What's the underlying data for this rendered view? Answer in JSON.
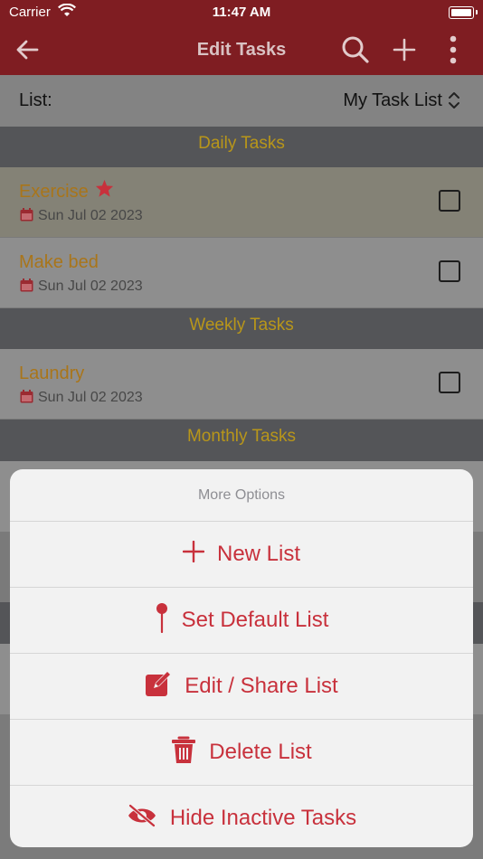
{
  "status_bar": {
    "carrier": "Carrier",
    "time": "11:47 AM"
  },
  "nav": {
    "title": "Edit Tasks"
  },
  "list_selector": {
    "label": "List:",
    "value": "My Task List"
  },
  "sections": [
    {
      "title": "Daily Tasks"
    },
    {
      "title": "Weekly Tasks"
    },
    {
      "title": "Monthly Tasks"
    }
  ],
  "tasks": [
    {
      "name": "Exercise",
      "date": "Sun Jul 02 2023",
      "starred": true
    },
    {
      "name": "Make bed",
      "date": "Sun Jul 02 2023",
      "starred": false
    },
    {
      "name": "Laundry",
      "date": "Sun Jul 02 2023",
      "starred": false
    }
  ],
  "sheet": {
    "title": "More Options",
    "options": [
      {
        "label": "New List",
        "icon": "plus-icon"
      },
      {
        "label": "Set Default List",
        "icon": "pin-icon"
      },
      {
        "label": "Edit / Share List",
        "icon": "edit-icon"
      },
      {
        "label": "Delete List",
        "icon": "trash-icon"
      },
      {
        "label": "Hide Inactive Tasks",
        "icon": "eye-slash-icon"
      }
    ]
  },
  "colors": {
    "nav_bg": "#7f1d22",
    "accent": "#c8313c",
    "section_text": "#b8961a",
    "task_text": "#a9751a"
  }
}
